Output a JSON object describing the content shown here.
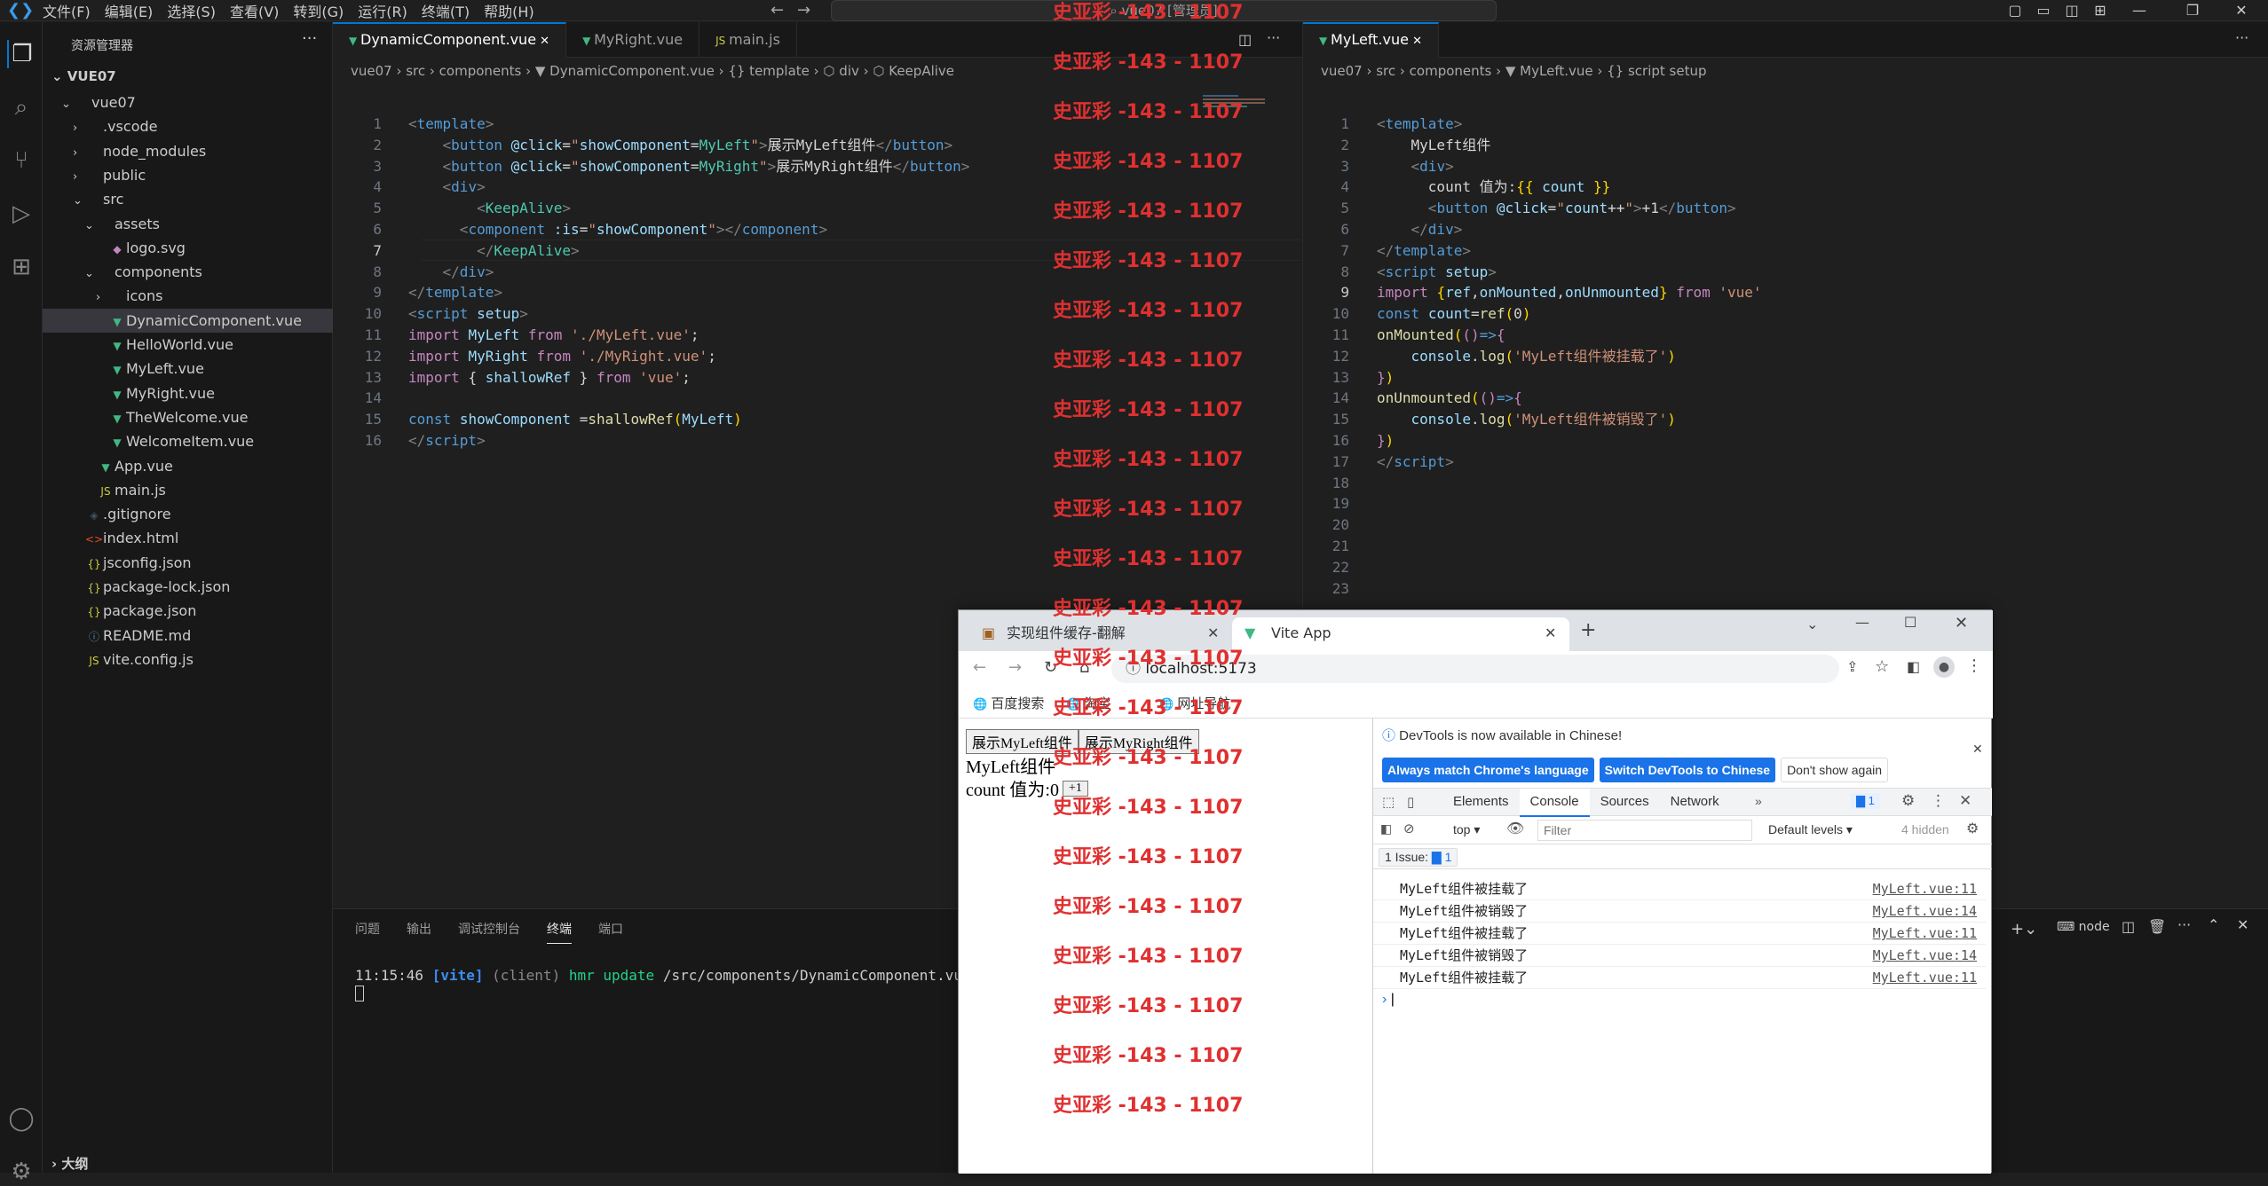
{
  "titlebar": {
    "menus": [
      "文件(F)",
      "编辑(E)",
      "选择(S)",
      "查看(V)",
      "转到(G)",
      "运行(R)",
      "终端(T)",
      "帮助(H)"
    ],
    "search": "vue07 [管理员]"
  },
  "sidebar": {
    "title": "资源管理器",
    "project": "VUE07",
    "outline": "大纲",
    "items": [
      {
        "label": "vue07",
        "indent": 1,
        "arrow": "⌄",
        "icon": ""
      },
      {
        "label": ".vscode",
        "indent": 2,
        "arrow": "›",
        "icon": ""
      },
      {
        "label": "node_modules",
        "indent": 2,
        "arrow": "›",
        "icon": ""
      },
      {
        "label": "public",
        "indent": 2,
        "arrow": "›",
        "icon": ""
      },
      {
        "label": "src",
        "indent": 2,
        "arrow": "⌄",
        "icon": ""
      },
      {
        "label": "assets",
        "indent": 3,
        "arrow": "⌄",
        "icon": ""
      },
      {
        "label": "logo.svg",
        "indent": 4,
        "arrow": "",
        "icon": "svg"
      },
      {
        "label": "components",
        "indent": 3,
        "arrow": "⌄",
        "icon": ""
      },
      {
        "label": "icons",
        "indent": 4,
        "arrow": "›",
        "icon": ""
      },
      {
        "label": "DynamicComponent.vue",
        "indent": 4,
        "arrow": "",
        "icon": "vue",
        "selected": true
      },
      {
        "label": "HelloWorld.vue",
        "indent": 4,
        "arrow": "",
        "icon": "vue"
      },
      {
        "label": "MyLeft.vue",
        "indent": 4,
        "arrow": "",
        "icon": "vue"
      },
      {
        "label": "MyRight.vue",
        "indent": 4,
        "arrow": "",
        "icon": "vue"
      },
      {
        "label": "TheWelcome.vue",
        "indent": 4,
        "arrow": "",
        "icon": "vue"
      },
      {
        "label": "WelcomeItem.vue",
        "indent": 4,
        "arrow": "",
        "icon": "vue"
      },
      {
        "label": "App.vue",
        "indent": 3,
        "arrow": "",
        "icon": "vue"
      },
      {
        "label": "main.js",
        "indent": 3,
        "arrow": "",
        "icon": "js"
      },
      {
        "label": ".gitignore",
        "indent": 2,
        "arrow": "",
        "icon": "git"
      },
      {
        "label": "index.html",
        "indent": 2,
        "arrow": "",
        "icon": "html"
      },
      {
        "label": "jsconfig.json",
        "indent": 2,
        "arrow": "",
        "icon": "json"
      },
      {
        "label": "package-lock.json",
        "indent": 2,
        "arrow": "",
        "icon": "json"
      },
      {
        "label": "package.json",
        "indent": 2,
        "arrow": "",
        "icon": "json"
      },
      {
        "label": "README.md",
        "indent": 2,
        "arrow": "",
        "icon": "info"
      },
      {
        "label": "vite.config.js",
        "indent": 2,
        "arrow": "",
        "icon": "js"
      }
    ]
  },
  "editor1": {
    "tabs": [
      "DynamicComponent.vue",
      "MyRight.vue",
      "main.js"
    ],
    "breadcrumb": "vue07 › src › components › ▼ DynamicComponent.vue › {} template › ⬡ div › ⬡ KeepAlive"
  },
  "editor2": {
    "tabs": [
      "MyLeft.vue"
    ],
    "breadcrumb": "vue07 › src › components › ▼ MyLeft.vue › {} script setup"
  },
  "panel": {
    "tabs": [
      "问题",
      "输出",
      "调试控制台",
      "终端",
      "端口"
    ],
    "terminal_time": "11:15:46",
    "terminal_tag": "[vite]",
    "terminal_client": "(client)",
    "terminal_msg": "hmr update",
    "terminal_path": "/src/components/DynamicComponent.vue",
    "shell": "node"
  },
  "browser": {
    "tab1": "实现组件缓存-翻解",
    "tab2": "Vite App",
    "url": "localhost:5173",
    "bookmarks": [
      "百度搜索",
      "淘宝",
      "网址导航"
    ],
    "page": {
      "btn_left": "展示MyLeft组件",
      "btn_right": "展示MyRight组件",
      "heading": "MyLeft组件",
      "count_label": "count 值为:0",
      "plus_btn": "+1"
    },
    "devtools": {
      "notice": "DevTools is now available in Chinese!",
      "btn_match": "Always match Chrome's language",
      "btn_switch": "Switch DevTools to Chinese",
      "btn_dont": "Don't show again",
      "tabs": [
        "Elements",
        "Console",
        "Sources",
        "Network"
      ],
      "badge": "1",
      "context": "top",
      "filter": "Filter",
      "levels": "Default levels",
      "hidden": "4 hidden",
      "issues": "1 Issue:",
      "issues_count": "1",
      "logs": [
        {
          "msg": "MyLeft组件被挂载了",
          "src": "MyLeft.vue:11"
        },
        {
          "msg": "MyLeft组件被销毁了",
          "src": "MyLeft.vue:14"
        },
        {
          "msg": "MyLeft组件被挂载了",
          "src": "MyLeft.vue:11"
        },
        {
          "msg": "MyLeft组件被销毁了",
          "src": "MyLeft.vue:14"
        },
        {
          "msg": "MyLeft组件被挂载了",
          "src": "MyLeft.vue:11"
        }
      ]
    }
  },
  "watermark": "史亚彩 -143 - 1107",
  "colors": {
    "accent": "#0078d4",
    "watermark": "#e03030",
    "vue_icon": "#41b883"
  }
}
